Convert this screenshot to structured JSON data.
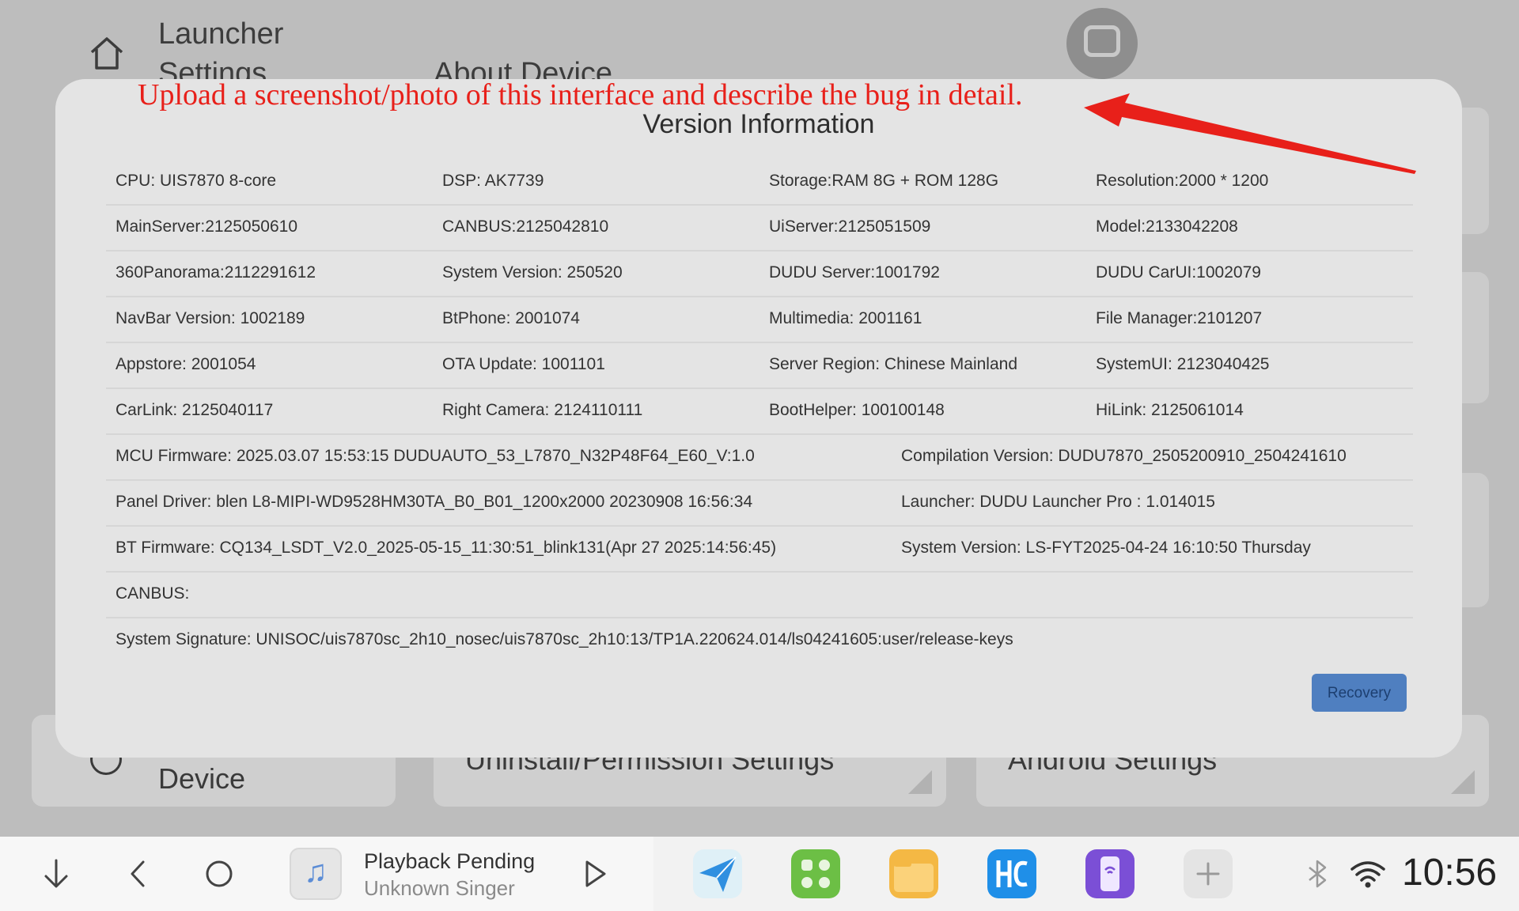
{
  "background": {
    "title": "Launcher Settings",
    "subtitle": "About Device",
    "cards": [
      {
        "label": "Device"
      },
      {
        "label": "Uninstall/Permission Settings"
      },
      {
        "label": "Android Settings"
      }
    ]
  },
  "annotation": {
    "text": "Upload a screenshot/photo of this interface and describe the bug in detail.",
    "color": "#e8201a"
  },
  "dialog": {
    "title": "Version Information",
    "grid_rows": [
      [
        "CPU:  UIS7870 8-core",
        "DSP:  AK7739",
        "Storage:RAM 8G + ROM 128G",
        "Resolution:2000 * 1200"
      ],
      [
        "MainServer:2125050610",
        "CANBUS:2125042810",
        "UiServer:2125051509",
        "Model:2133042208"
      ],
      [
        "360Panorama:2112291612",
        "System Version:  250520",
        "DUDU Server:1001792",
        "DUDU CarUI:1002079"
      ],
      [
        "NavBar Version:  1002189",
        "BtPhone:   2001074",
        "Multimedia:   2001161",
        "File Manager:2101207"
      ],
      [
        "Appstore:   2001054",
        "OTA Update:   1001101",
        "Server Region:  Chinese Mainland",
        "SystemUI:   2123040425"
      ],
      [
        "CarLink:   2125040117",
        "Right Camera:   2124110111",
        "BootHelper: 100100148",
        "HiLink:   2125061014"
      ]
    ],
    "wide_rows": [
      [
        "MCU Firmware:  2025.03.07 15:53:15 DUDUAUTO_53_L7870_N32P48F64_E60_V:1.0",
        "Compilation Version:  DUDU7870_2505200910_2504241610"
      ],
      [
        "Panel Driver:  blen L8-MIPI-WD9528HM30TA_B0_B01_1200x2000 20230908 16:56:34",
        "Launcher:  DUDU Launcher Pro : 1.014015"
      ],
      [
        "BT Firmware:  CQ134_LSDT_V2.0_2025-05-15_11:30:51_blink131(Apr 27 2025:14:56:45)",
        "System Version:  LS-FYT2025-04-24 16:10:50 Thursday"
      ]
    ],
    "canbus": "CANBUS:",
    "signature": "System Signature:  UNISOC/uis7870sc_2h10_nosec/uis7870sc_2h10:13/TP1A.220624.014/ls04241605:user/release-keys",
    "recovery_label": "Recovery"
  },
  "taskbar": {
    "track_title": "Playback Pending",
    "track_artist": "Unknown Singer",
    "time": "10:56",
    "icons": [
      "down-arrow-icon",
      "back-icon",
      "home-circle-icon",
      "music-note-icon",
      "play-icon",
      "navigation-app-icon",
      "apps-grid-icon",
      "file-manager-icon",
      "hicar-app-icon",
      "phone-link-icon",
      "add-icon",
      "bluetooth-icon",
      "wifi-icon"
    ]
  }
}
